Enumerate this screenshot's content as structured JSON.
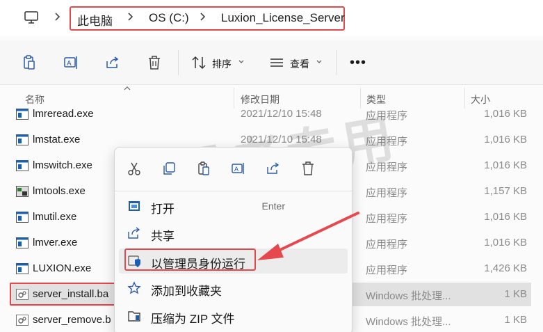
{
  "address": {
    "crumbs": [
      "此电脑",
      "OS (C:)",
      "Luxion_License_Server"
    ]
  },
  "toolbar": {
    "sort_label": "排序",
    "view_label": "查看",
    "more_label": "•••"
  },
  "columns": {
    "name": "名称",
    "date": "修改日期",
    "type": "类型",
    "size": "大小"
  },
  "files": [
    {
      "name": "lmreread.exe",
      "date": "2021/12/10 15:48",
      "type": "应用程序",
      "size": "1,016 KB",
      "icon": "exe-icon"
    },
    {
      "name": "lmstat.exe",
      "date": "2021/12/10 15:48",
      "type": "应用程序",
      "size": "1,016 KB",
      "icon": "exe-icon"
    },
    {
      "name": "lmswitch.exe",
      "date": "",
      "type": "应用程序",
      "size": "1,016 KB",
      "icon": "exe-icon"
    },
    {
      "name": "lmtools.exe",
      "date": "",
      "type": "应用程序",
      "size": "1,157 KB",
      "icon": "tools-icon"
    },
    {
      "name": "lmutil.exe",
      "date": "",
      "type": "应用程序",
      "size": "1,016 KB",
      "icon": "exe-icon"
    },
    {
      "name": "lmver.exe",
      "date": "",
      "type": "应用程序",
      "size": "1,016 KB",
      "icon": "exe-icon"
    },
    {
      "name": "LUXION.exe",
      "date": "",
      "type": "应用程序",
      "size": "1,426 KB",
      "icon": "exe-icon"
    },
    {
      "name": "server_install.ba",
      "date": "",
      "type": "Windows 批处理...",
      "size": "1 KB",
      "icon": "batch-icon"
    },
    {
      "name": "server_remove.b",
      "date": "",
      "type": "Windows 批处理...",
      "size": "1 KB",
      "icon": "batch-icon"
    }
  ],
  "context_menu": {
    "top_icons": [
      "cut-icon",
      "copy-icon",
      "paste-icon",
      "rename-icon",
      "share-icon",
      "delete-icon"
    ],
    "items": [
      {
        "label": "打开",
        "shortcut": "Enter",
        "icon": "open-icon"
      },
      {
        "label": "共享",
        "shortcut": "",
        "icon": "share-icon"
      },
      {
        "label": "以管理员身份运行",
        "shortcut": "",
        "icon": "admin-shield-icon"
      },
      {
        "label": "添加到收藏夹",
        "shortcut": "",
        "icon": "star-icon"
      },
      {
        "label": "压缩为 ZIP 文件",
        "shortcut": "",
        "icon": "zip-icon"
      }
    ]
  },
  "watermark": "7号老专用",
  "colors": {
    "highlight_red": "#e5484d",
    "selected_row": "#e1e1e1",
    "accent_blue": "#1a5fb4"
  }
}
